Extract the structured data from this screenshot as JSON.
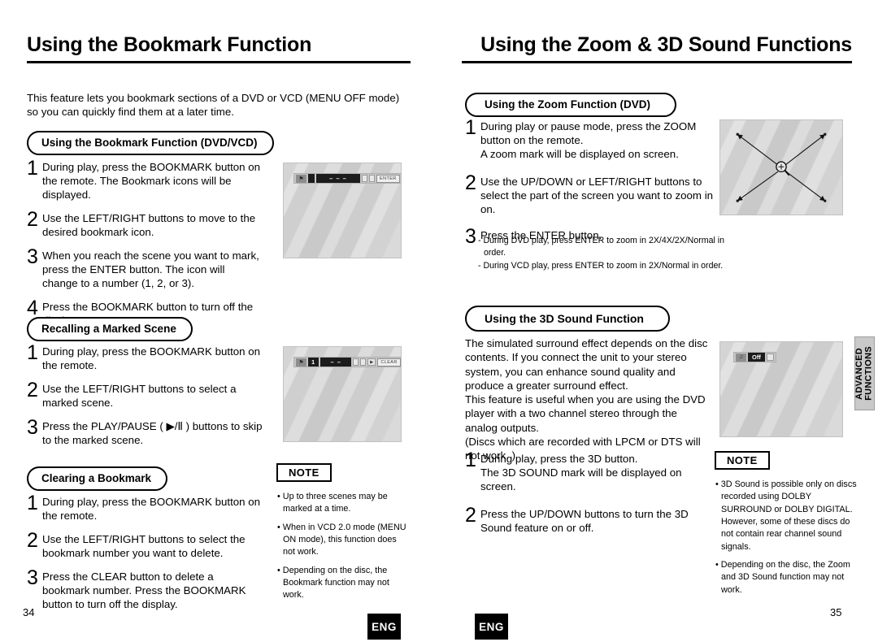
{
  "left_page": {
    "title": "Using the Bookmark Function",
    "number": "34",
    "lang_badge": "ENG",
    "intro": "This feature lets you bookmark sections of a DVD or VCD (MENU OFF mode) so you can quickly find them at a later time.",
    "sections": [
      {
        "heading": "Using the Bookmark Function (DVD/VCD)",
        "steps": [
          {
            "num": "1",
            "text": "During play, press the BOOKMARK button on the remote. The Bookmark icons will be displayed."
          },
          {
            "num": "2",
            "text": "Use the LEFT/RIGHT buttons to move to the desired bookmark icon."
          },
          {
            "num": "3",
            "text": "When you reach the scene you want to mark, press the ENTER button. The icon will change to a number (1, 2, or 3)."
          },
          {
            "num": "4",
            "text": "Press the BOOKMARK button to turn off the display."
          }
        ]
      },
      {
        "heading": "Recalling a Marked Scene",
        "steps": [
          {
            "num": "1",
            "text": "During play, press the BOOKMARK button on the remote."
          },
          {
            "num": "2",
            "text": "Use the LEFT/RIGHT buttons to select a marked scene."
          },
          {
            "num": "3",
            "text": "Press the PLAY/PAUSE ( ▶/Ⅱ ) buttons to skip to the marked scene."
          }
        ]
      },
      {
        "heading": "Clearing a Bookmark",
        "steps": [
          {
            "num": "1",
            "text": "During play, press the BOOKMARK button on the remote."
          },
          {
            "num": "2",
            "text": "Use the LEFT/RIGHT buttons to select the bookmark number you want to delete."
          },
          {
            "num": "3",
            "text": "Press the CLEAR button to delete a bookmark number. Press the BOOKMARK button to turn off the display."
          }
        ]
      }
    ],
    "note": {
      "label": "NOTE",
      "items": [
        "Up to three scenes may be marked at a time.",
        "When in VCD 2.0 mode (MENU ON mode), this function does not work.",
        "Depending on the disc, the Bookmark function may not work."
      ]
    },
    "screens": [
      {
        "name": "bookmark-osd-screen",
        "osd": {
          "icon": "bookmark-icon",
          "marker": "",
          "dashes": "–   –   –",
          "chips": [
            "□",
            "□"
          ],
          "action": "ENTER"
        }
      },
      {
        "name": "bookmark-marked-osd-screen",
        "osd": {
          "icon": "bookmark-icon",
          "marker": "1",
          "dashes": "–   –",
          "chips": [
            "□",
            "□",
            "▶"
          ],
          "action": "CLEAR"
        }
      }
    ]
  },
  "right_page": {
    "title": "Using the Zoom & 3D Sound Functions",
    "number": "35",
    "lang_badge": "ENG",
    "sections": [
      {
        "heading": "Using the Zoom Function (DVD)",
        "steps": [
          {
            "num": "1",
            "text": "During play or pause mode, press the ZOOM button on the remote.\nA zoom mark will be displayed on screen."
          },
          {
            "num": "2",
            "text": "Use the UP/DOWN or LEFT/RIGHT buttons to select the part of the screen you want to zoom in on."
          },
          {
            "num": "3",
            "text": "Press the ENTER button."
          }
        ],
        "dash_notes": [
          "- During DVD play, press ENTER to zoom in 2X/4X/2X/Normal in order.",
          "- During VCD play, press ENTER to zoom in 2X/Normal in order."
        ]
      },
      {
        "heading": "Using the 3D Sound Function",
        "paragraph": "The simulated surround effect depends on the disc contents. If you connect the unit to your stereo system, you can enhance sound quality and produce a greater surround effect.\nThis feature is useful when you are using the DVD player with a two channel stereo through the analog outputs.\n(Discs which are recorded with LPCM or DTS will not work. )",
        "steps": [
          {
            "num": "1",
            "text": "During play, press the 3D button.\nThe 3D SOUND mark will be displayed on screen."
          },
          {
            "num": "2",
            "text": "Press the UP/DOWN buttons to turn the 3D Sound feature on or off."
          }
        ]
      }
    ],
    "note": {
      "label": "NOTE",
      "items": [
        "3D Sound is possible only on discs recorded using DOLBY SURROUND or DOLBY DIGITAL. However, some of these discs do not contain rear channel sound signals.",
        "Depending on the disc, the Zoom and 3D Sound function may not work."
      ]
    },
    "screens": [
      {
        "name": "zoom-mark-screen",
        "icon": "magnifier-crosshair-icon"
      },
      {
        "name": "3d-sound-osd-screen",
        "osd": {
          "icon": "3d-sound-icon",
          "value": "Off",
          "chip": "↕"
        }
      }
    ],
    "side_tab": "ADVANCED\nFUNCTIONS"
  }
}
